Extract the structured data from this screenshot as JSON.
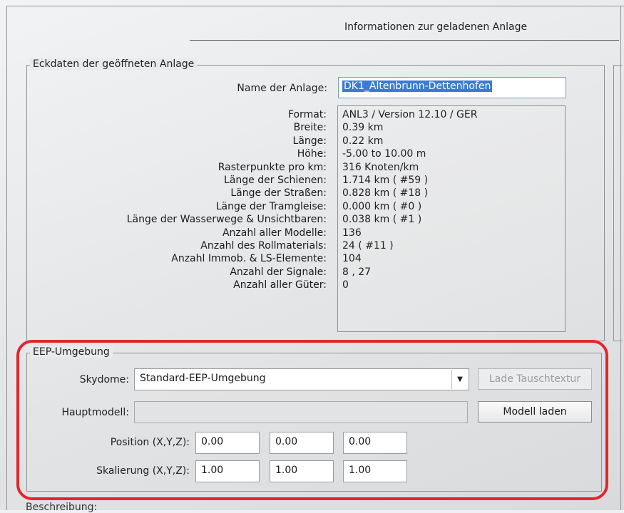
{
  "header": {
    "title": "Informationen zur geladenen Anlage"
  },
  "eckdaten": {
    "legend": "Eckdaten der geöffneten Anlage",
    "name_label": "Name der Anlage:",
    "name_value": "DK1_Altenbrunn-Dettenhofen",
    "info": [
      {
        "label": "Format:",
        "value": "ANL3 / Version 12.10 / GER"
      },
      {
        "label": "Breite:",
        "value": "0.39 km"
      },
      {
        "label": "Länge:",
        "value": "0.22 km"
      },
      {
        "label": "Höhe:",
        "value": "-5.00 to 10.00 m"
      },
      {
        "label": "Rasterpunkte pro km:",
        "value": "316 Knoten/km"
      },
      {
        "label": "Länge der Schienen:",
        "value": "1.714 km ( #59 )"
      },
      {
        "label": "Länge der Straßen:",
        "value": "0.828 km ( #18 )"
      },
      {
        "label": "Länge der Tramgleise:",
        "value": "0.000 km ( #0 )"
      },
      {
        "label": "Länge der Wasserwege & Unsichtbaren:",
        "value": "0.038 km ( #1 )"
      },
      {
        "label": "Anzahl aller Modelle:",
        "value": "136"
      },
      {
        "label": "Anzahl des Rollmaterials:",
        "value": "24 ( #11 )"
      },
      {
        "label": "Anzahl Immob. & LS-Elemente:",
        "value": "104"
      },
      {
        "label": "Anzahl der Signale:",
        "value": "8 , 27"
      },
      {
        "label": "Anzahl aller Güter:",
        "value": "0"
      }
    ]
  },
  "eep": {
    "legend": "EEP-Umgebung",
    "skydome_label": "Skydome:",
    "skydome_value": "Standard-EEP-Umgebung",
    "lade_button": "Lade Tauschtextur",
    "hauptmodell_label": "Hauptmodell:",
    "hauptmodell_value": "",
    "modell_button": "Modell laden",
    "position_label": "Position (X,Y,Z):",
    "position": [
      "0.00",
      "0.00",
      "0.00"
    ],
    "skalierung_label": "Skalierung (X,Y,Z):",
    "skalierung": [
      "1.00",
      "1.00",
      "1.00"
    ]
  },
  "beschreibung": {
    "label": "Beschreibung:"
  },
  "colors": {
    "highlight": "#e3262b",
    "selection": "#3b7bd1"
  }
}
